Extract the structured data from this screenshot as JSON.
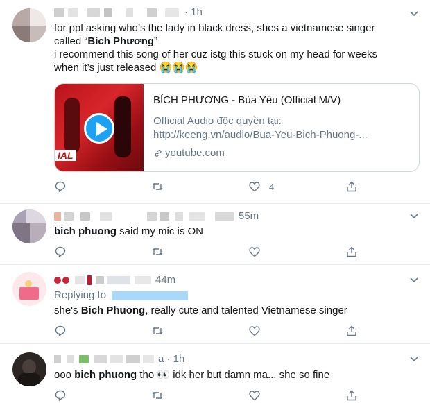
{
  "colors": {
    "accent": "#1da1f2",
    "muted": "#657786",
    "text": "#14171a",
    "border": "#e6ecf0"
  },
  "tweets": [
    {
      "time": "· 1h",
      "lines": [
        "for ppl asking who’s the lady in black dress, shes a vietnamese singer",
        "called “",
        "Bích Phương",
        "”",
        "i recommend this song of her cuz istg this stuck on my head for weeks",
        "when it’s just released"
      ],
      "emoji": "😭😭😭",
      "card": {
        "title": "BÍCH PHƯƠNG - Bùa Yêu (Official M/V)",
        "desc_line1": "Official Audio độc quyền tại:",
        "desc_line2": "http://keeng.vn/audio/Bua-Yeu-Bich-Phuong-...",
        "domain": "youtube.com",
        "thumb_text": "IAL"
      },
      "likes": "4"
    },
    {
      "time": "55m",
      "bold": "bich phuong",
      "rest": " said my mic is ON"
    },
    {
      "time": "44m",
      "replying": "Replying to",
      "pre": "she's ",
      "bold": "Bich Phuong",
      "rest": ", really cute and talented Vietnamese singer"
    },
    {
      "time": "a · 1h",
      "pre": "ooo ",
      "bold": "bich phuong",
      "rest": " tho 👀 idk her but damn ma... she so fine"
    }
  ]
}
